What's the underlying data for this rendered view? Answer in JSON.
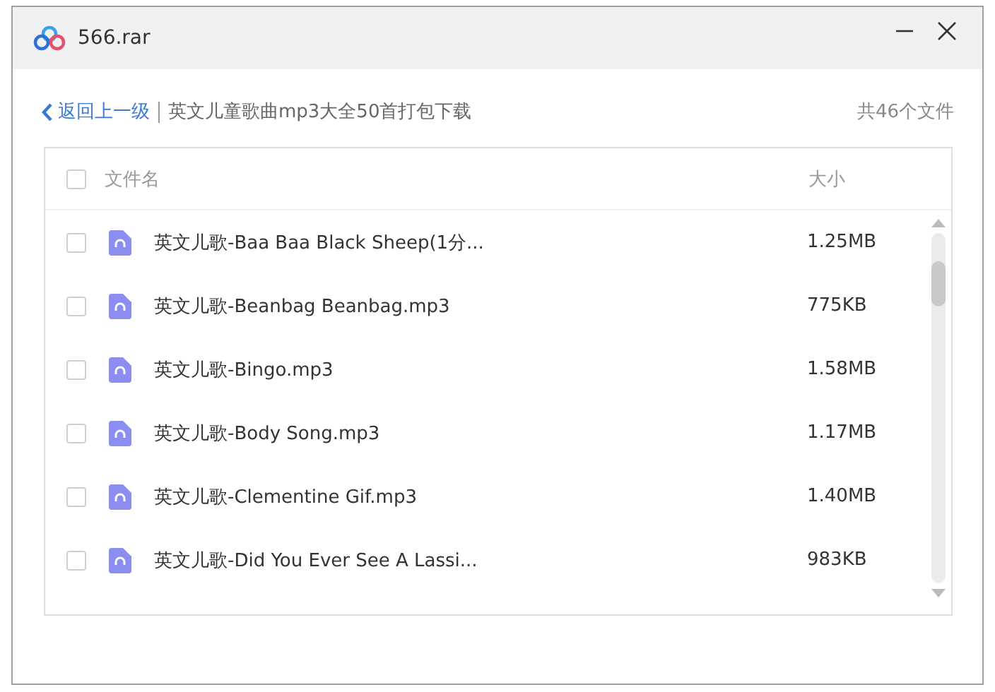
{
  "window": {
    "title": "566.rar"
  },
  "nav": {
    "back": "返回上一级",
    "path": "英文儿童歌曲mp3大全50首打包下载",
    "count": "共46个文件"
  },
  "table": {
    "columns": [
      "文件名",
      "大小"
    ],
    "all_checked": false,
    "rows": [
      {
        "name": "英文儿歌-Baa Baa Black Sheep(1分...",
        "size": "1.25MB",
        "checked": false
      },
      {
        "name": "英文儿歌-Beanbag Beanbag.mp3",
        "size": "775KB",
        "checked": false
      },
      {
        "name": "英文儿歌-Bingo.mp3",
        "size": "1.58MB",
        "checked": false
      },
      {
        "name": "英文儿歌-Body Song.mp3",
        "size": "1.17MB",
        "checked": false
      },
      {
        "name": "英文儿歌-Clementine Gif.mp3",
        "size": "1.40MB",
        "checked": false
      },
      {
        "name": "英文儿歌-Did You Ever See A Lassi...",
        "size": "983KB",
        "checked": false
      }
    ]
  }
}
